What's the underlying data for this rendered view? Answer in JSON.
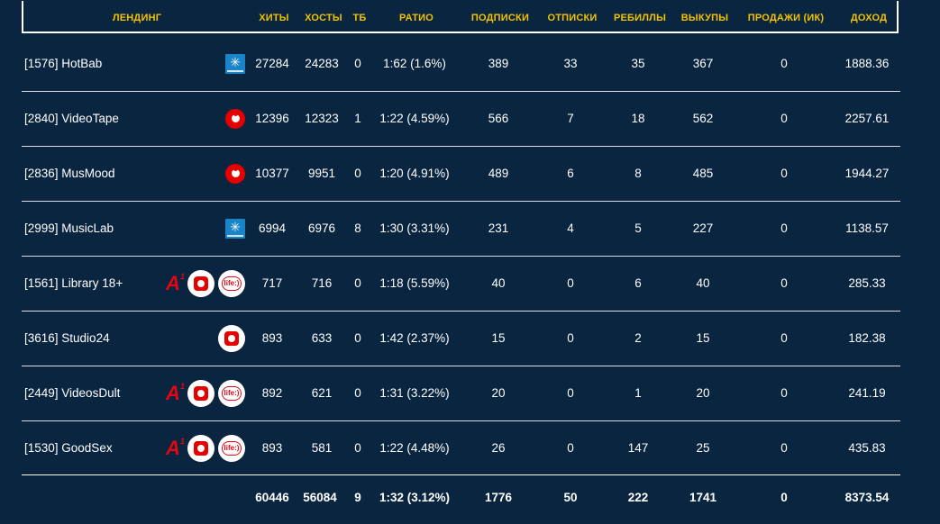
{
  "columns": {
    "landing": "ЛЕНДИНГ",
    "hits": "ХИТЫ",
    "hosts": "ХОСТЫ",
    "tb": "ТБ",
    "ratio": "РАТИО",
    "subs": "ПОДПИСКИ",
    "unsubs": "ОТПИСКИ",
    "rebills": "РЕБИЛЛЫ",
    "buyouts": "ВЫКУПЫ",
    "sales": "ПРОДАЖИ (ИК)",
    "income": "ДОХОД"
  },
  "rows": [
    {
      "name": "[1576] HotBab",
      "operators": [
        "kyivstar"
      ],
      "hits": "27284",
      "hosts": "24283",
      "tb": "0",
      "ratio": "1:62 (1.6%)",
      "subs": "389",
      "unsubs": "33",
      "rebills": "35",
      "buyouts": "367",
      "sales": "0",
      "income": "1888.36"
    },
    {
      "name": "[2840] VideoTape",
      "operators": [
        "vodafone"
      ],
      "hits": "12396",
      "hosts": "12323",
      "tb": "1",
      "ratio": "1:22 (4.59%)",
      "subs": "566",
      "unsubs": "7",
      "rebills": "18",
      "buyouts": "562",
      "sales": "0",
      "income": "2257.61"
    },
    {
      "name": "[2836] MusMood",
      "operators": [
        "vodafone"
      ],
      "hits": "10377",
      "hosts": "9951",
      "tb": "0",
      "ratio": "1:20 (4.91%)",
      "subs": "489",
      "unsubs": "6",
      "rebills": "8",
      "buyouts": "485",
      "sales": "0",
      "income": "1944.27"
    },
    {
      "name": "[2999] MusicLab",
      "operators": [
        "kyivstar"
      ],
      "hits": "6994",
      "hosts": "6976",
      "tb": "8",
      "ratio": "1:30 (3.31%)",
      "subs": "231",
      "unsubs": "4",
      "rebills": "5",
      "buyouts": "227",
      "sales": "0",
      "income": "1138.57"
    },
    {
      "name": "[1561] Library 18+",
      "operators": [
        "a1",
        "vodafone-circle",
        "life-circle"
      ],
      "hits": "717",
      "hosts": "716",
      "tb": "0",
      "ratio": "1:18 (5.59%)",
      "subs": "40",
      "unsubs": "0",
      "rebills": "6",
      "buyouts": "40",
      "sales": "0",
      "income": "285.33"
    },
    {
      "name": "[3616] Studio24",
      "operators": [
        "vodafone-circle"
      ],
      "hits": "893",
      "hosts": "633",
      "tb": "0",
      "ratio": "1:42 (2.37%)",
      "subs": "15",
      "unsubs": "0",
      "rebills": "2",
      "buyouts": "15",
      "sales": "0",
      "income": "182.38"
    },
    {
      "name": "[2449] VideosDult",
      "operators": [
        "a1",
        "vodafone-circle",
        "life-circle"
      ],
      "hits": "892",
      "hosts": "621",
      "tb": "0",
      "ratio": "1:31 (3.22%)",
      "subs": "20",
      "unsubs": "0",
      "rebills": "1",
      "buyouts": "20",
      "sales": "0",
      "income": "241.19"
    },
    {
      "name": "[1530] GoodSex",
      "operators": [
        "a1",
        "vodafone-circle",
        "life-circle"
      ],
      "hits": "893",
      "hosts": "581",
      "tb": "0",
      "ratio": "1:22 (4.48%)",
      "subs": "26",
      "unsubs": "0",
      "rebills": "147",
      "buyouts": "25",
      "sales": "0",
      "income": "435.83"
    }
  ],
  "totals": {
    "hits": "60446",
    "hosts": "56084",
    "tb": "9",
    "ratio": "1:32 (3.12%)",
    "subs": "1776",
    "unsubs": "50",
    "rebills": "222",
    "buyouts": "1741",
    "sales": "0",
    "income": "8373.54"
  },
  "icon_text": {
    "a1": "A",
    "a1_sup": "1",
    "life": "life:)"
  },
  "colors": {
    "background": "#0a2540",
    "header_text": "#f2c200",
    "vodafone": "#e60000",
    "kyivstar": "#1a84c9",
    "a1": "#e30613"
  }
}
